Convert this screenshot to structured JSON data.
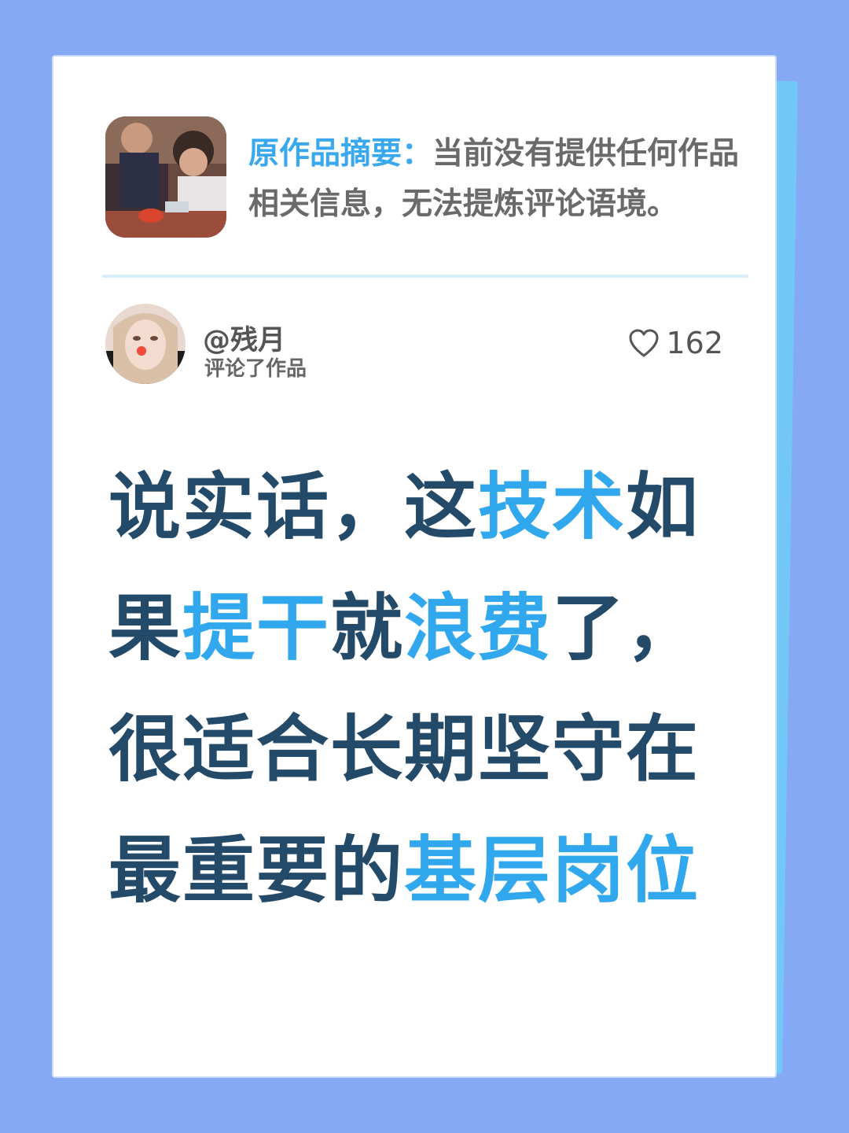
{
  "summary": {
    "label": "原作品摘要：",
    "text": "当前没有提供任何作品相关信息，无法提炼评论语境。"
  },
  "comment": {
    "username": "@残月",
    "action": "评论了作品",
    "likes": "162",
    "segments": [
      {
        "text": "说实话，这",
        "highlight": false
      },
      {
        "text": "技术",
        "highlight": true
      },
      {
        "text": "如果",
        "highlight": false
      },
      {
        "text": "提干",
        "highlight": true
      },
      {
        "text": "就",
        "highlight": false
      },
      {
        "text": "浪费",
        "highlight": true
      },
      {
        "text": "了，很适合长期坚守在最重要的",
        "highlight": false
      },
      {
        "text": "基层岗位",
        "highlight": true
      }
    ]
  },
  "icons": {
    "like": "heart-outline-icon"
  },
  "colors": {
    "background": "#86a9f6",
    "accent": "#31a8ee",
    "quote_text": "#244a6a"
  }
}
